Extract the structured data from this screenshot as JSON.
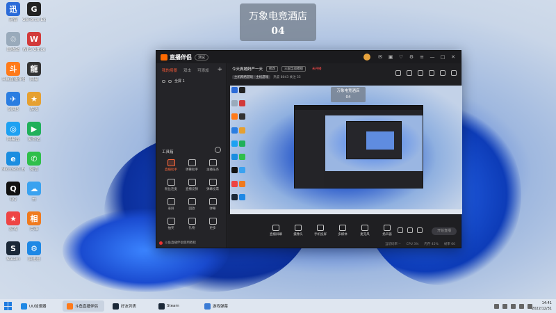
{
  "overlay": {
    "line1": "万象电竞酒店",
    "line2": "04"
  },
  "desktop_icons": [
    {
      "label": "迅雷",
      "color": "#2b6bd8",
      "glyph": "迅"
    },
    {
      "label": "GeForce Experience",
      "color": "#222",
      "glyph": "G"
    },
    {
      "label": "回收站",
      "color": "#9ab",
      "glyph": "♲"
    },
    {
      "label": "WPS Office",
      "color": "#d23a3a",
      "glyph": "W"
    },
    {
      "label": "斗鱼直播伴侣",
      "color": "#ff7a1a",
      "glyph": "斗"
    },
    {
      "label": "网易",
      "color": "#333",
      "glyph": "龍"
    },
    {
      "label": "剑网3",
      "color": "#2a7de1",
      "glyph": "✈"
    },
    {
      "label": "游戏",
      "color": "#e6a030",
      "glyph": "★"
    },
    {
      "label": "网易云",
      "color": "#1da1f2",
      "glyph": "◎"
    },
    {
      "label": "爱奇艺",
      "color": "#20b05a",
      "glyph": "▶"
    },
    {
      "label": "Microsoft Edge",
      "color": "#1a8de0",
      "glyph": "e"
    },
    {
      "label": "微信",
      "color": "#2fbf4a",
      "glyph": "✆"
    },
    {
      "label": "QQ",
      "color": "#111",
      "glyph": "Q"
    },
    {
      "label": "云",
      "color": "#3aa2f0",
      "glyph": "☁"
    },
    {
      "label": "游戏",
      "color": "#e44",
      "glyph": "★"
    },
    {
      "label": "英雄",
      "color": "#f07a1e",
      "glyph": "相"
    },
    {
      "label": "Steam",
      "color": "#1b2838",
      "glyph": "S"
    },
    {
      "label": "加速器",
      "color": "#1e88e5",
      "glyph": "⚙"
    }
  ],
  "app": {
    "name": "直播伴侣",
    "version": "测试",
    "left_tabs": [
      "我的场景",
      "双击",
      "可添加"
    ],
    "scene": "全屏 1",
    "tools_title": "工具箱",
    "tools": [
      {
        "label": "直播助手",
        "accent": true
      },
      {
        "label": "弹幕助手",
        "accent": false
      },
      {
        "label": "主播任务",
        "accent": false
      },
      {
        "label": "粉丝连麦",
        "accent": false
      },
      {
        "label": "直播竞猜",
        "accent": false
      },
      {
        "label": "弹幕投票",
        "accent": false
      },
      {
        "label": "录屏",
        "accent": false
      },
      {
        "label": "回放",
        "accent": false
      },
      {
        "label": "弹幕",
        "accent": false
      },
      {
        "label": "抽奖",
        "accent": false
      },
      {
        "label": "礼物",
        "accent": false
      },
      {
        "label": "更多",
        "accent": false
      }
    ],
    "footer": "斗鱼直播伴侣使用教程",
    "stream_title": "今天真她妈严一天",
    "edit_pill": "修改",
    "room_pill": "三国全战模组",
    "live_status": "未开播",
    "tag1": "主机网络游戏 · 主机游戏",
    "stats": "热度 8043  关注 55",
    "preview_title": "万象电竞酒店",
    "preview_sub": "04",
    "controls": [
      "直播屏幕",
      "摄像头",
      "手机投屏",
      "多媒体",
      "麦克风",
      "扬声器"
    ],
    "start_label": "开始直播",
    "status": [
      "当前码率 --",
      "CPU 3%",
      "内存 45%",
      "帧率 60"
    ]
  },
  "taskbar": {
    "apps": [
      {
        "label": "UU加速器",
        "color": "#1e88e5"
      },
      {
        "label": "斗鱼直播伴侣",
        "color": "#ff7a1a"
      },
      {
        "label": "好友列表",
        "color": "#1b2838"
      },
      {
        "label": "Steam",
        "color": "#1b2838"
      },
      {
        "label": "游戏弹幕",
        "color": "#3a7bd5"
      }
    ],
    "time": "14:41",
    "date": "2022/12/31"
  }
}
